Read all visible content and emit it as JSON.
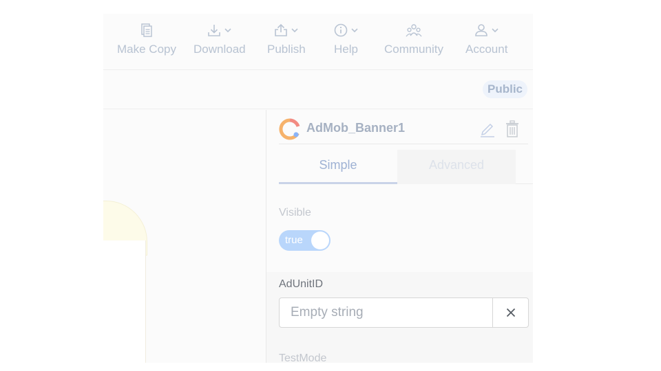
{
  "toolbar": {
    "items": [
      {
        "label": "Make Copy",
        "icon": "copy-icon",
        "has_dropdown": false
      },
      {
        "label": "Download",
        "icon": "download-icon",
        "has_dropdown": true
      },
      {
        "label": "Publish",
        "icon": "publish-icon",
        "has_dropdown": true
      },
      {
        "label": "Help",
        "icon": "info-icon",
        "has_dropdown": true
      },
      {
        "label": "Community",
        "icon": "community-icon",
        "has_dropdown": false
      },
      {
        "label": "Account",
        "icon": "user-icon",
        "has_dropdown": true
      }
    ]
  },
  "subbar": {
    "visibility_badge": "Public"
  },
  "component": {
    "name": "AdMob_Banner1",
    "icon": "admob-icon",
    "tabs": {
      "simple": "Simple",
      "advanced": "Advanced"
    },
    "properties": {
      "visible": {
        "label": "Visible",
        "value": "true"
      },
      "ad_unit_id": {
        "label": "AdUnitID",
        "value": "",
        "placeholder": "Empty string"
      },
      "test_mode": {
        "label": "TestMode"
      }
    }
  },
  "colors": {
    "toolbar_icon": "#b9c4d3",
    "toggle_on": "#b9d6fb",
    "tab_active": "#9fb2d4",
    "badge_bg": "#eef3fb"
  }
}
